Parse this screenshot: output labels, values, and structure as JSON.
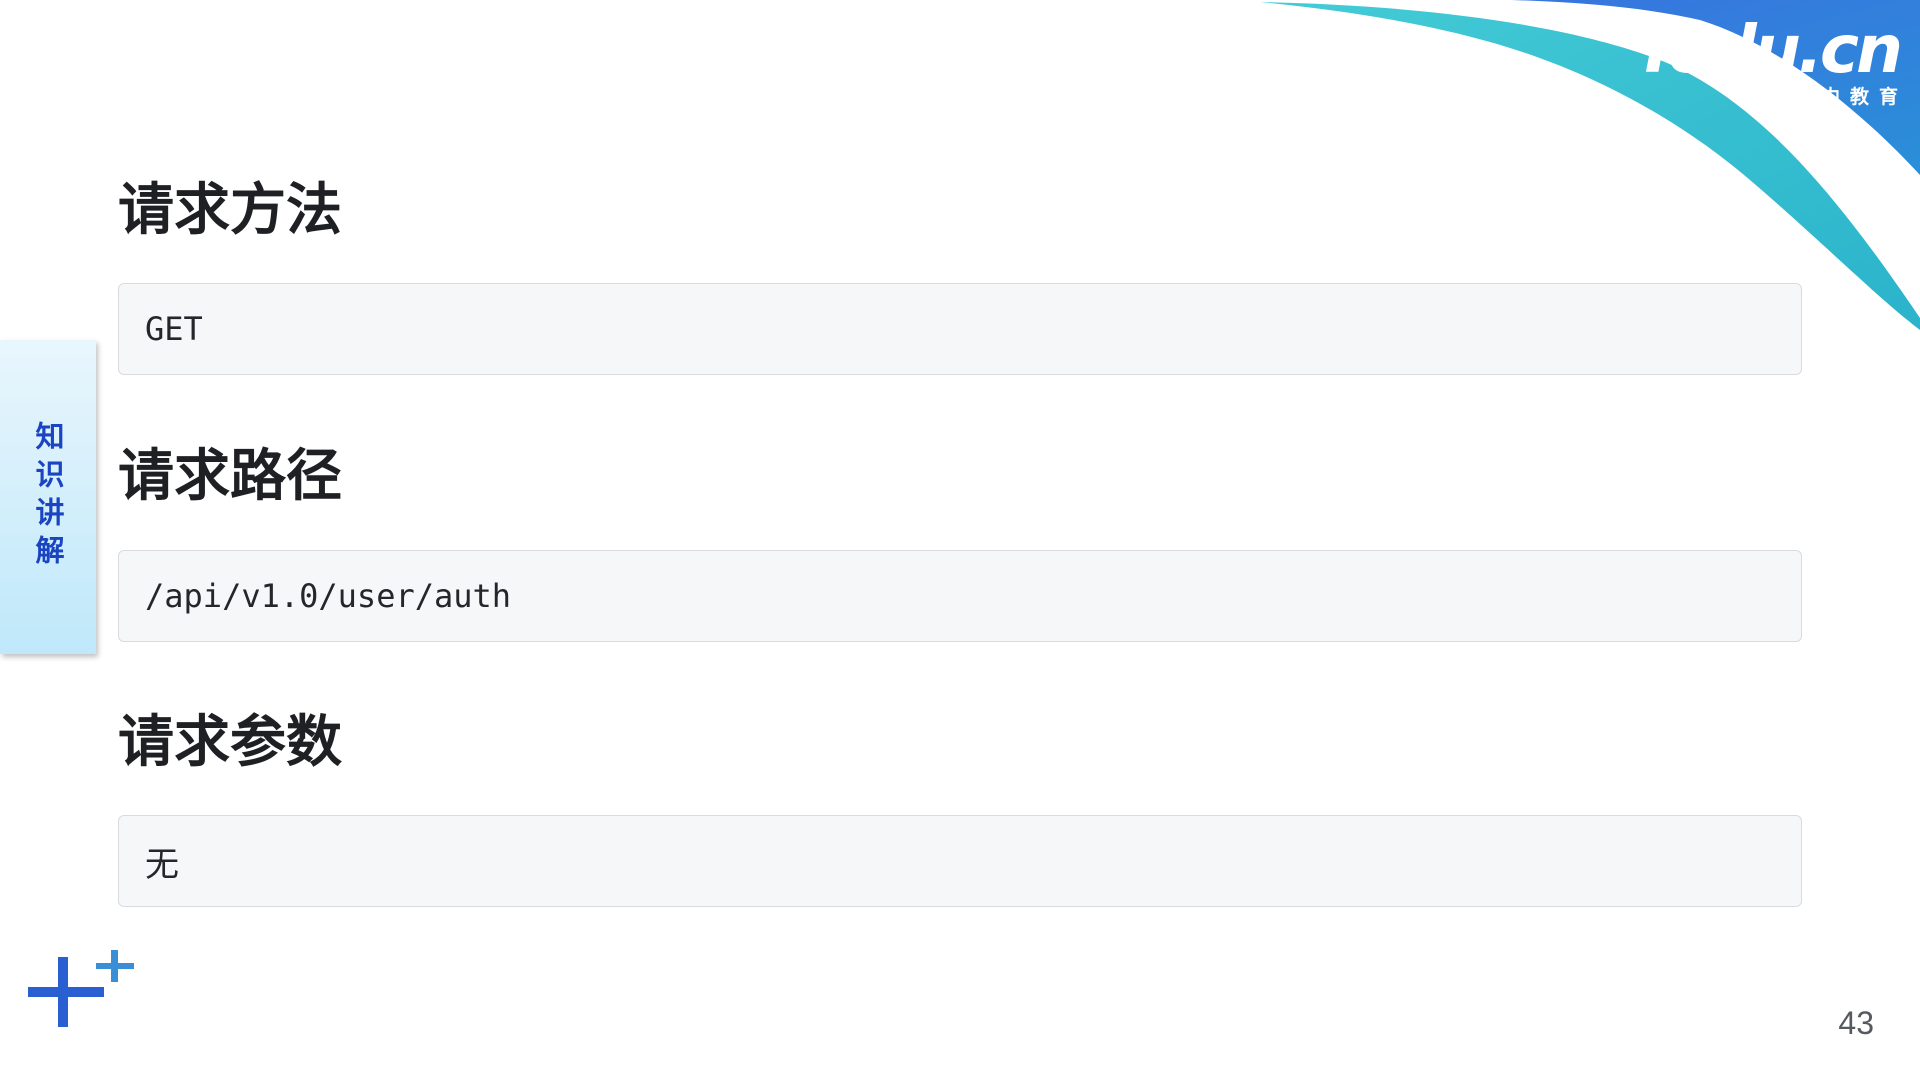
{
  "brand": {
    "wordmark": "Tedu.cn",
    "tagline": "达内教育",
    "colors": {
      "teal": "#33c1d1",
      "blue": "#2f5fd6",
      "white": "#ffffff"
    }
  },
  "side_tab": {
    "label": "知识讲解",
    "text_color": "#1b44c2",
    "background": "#d6f0fb"
  },
  "sections": [
    {
      "heading": "请求方法",
      "value": "GET"
    },
    {
      "heading": "请求路径",
      "value": "/api/v1.0/user/auth"
    },
    {
      "heading": "请求参数",
      "value": "无"
    }
  ],
  "decoration": {
    "icon": "plus-icon",
    "colors": [
      "#2a5fd1",
      "#3a8ed6"
    ]
  },
  "page_number": "43"
}
